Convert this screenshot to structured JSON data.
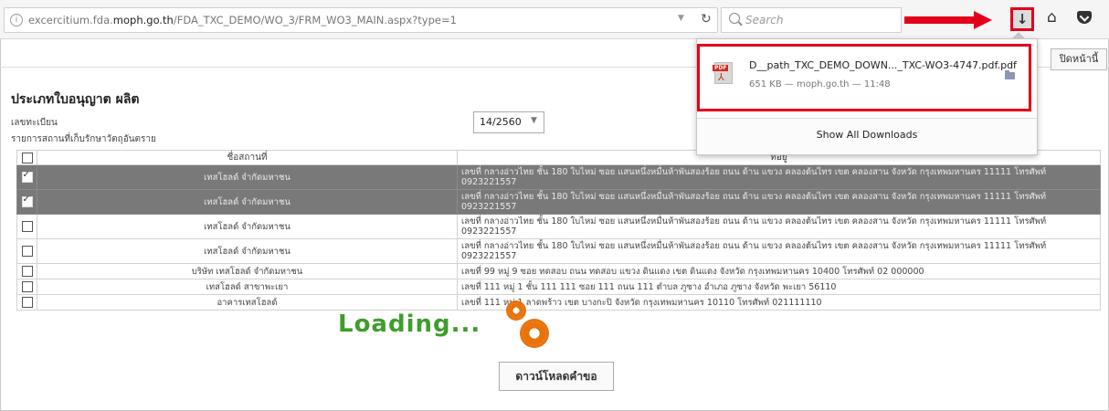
{
  "browser": {
    "url_host_prefix": "excercitium.fda.",
    "url_host_bold": "moph.go.th",
    "url_path": "/FDA_TXC_DEMO/WO_3/FRM_WO3_MAIN.aspx?type=1",
    "search_placeholder": "Search",
    "icons": [
      "info-icon",
      "dropdown-icon",
      "reload-icon",
      "search-icon",
      "download-icon",
      "home-icon",
      "pocket-icon"
    ],
    "highlight_color": "#e3001b"
  },
  "downloads_panel": {
    "filename": "D__path_TXC_DEMO_DOWN..._TXC-WO3-4747.pdf.pdf",
    "meta": "651 KB — moph.go.th — 11:48",
    "show_all_label": "Show All Downloads"
  },
  "page": {
    "top_right_button": "ปิดหน้านี้",
    "title": "ประเภทใบอนุญาต ผลิต",
    "registration_label": "เลขทะเบียน",
    "storage_label": "รายการสถานที่เก็บรักษาวัตถุอันตราย",
    "registration_value": "14/2560",
    "table": {
      "columns": [
        "",
        "ชื่อสถานที่",
        "ที่อยู่"
      ],
      "rows": [
        {
          "checked": true,
          "selected": true,
          "name": "เทสโฮลด์ จำกัดมหาชน",
          "address": "เลขที่ กลางอ่าวไทย ชั้น 180 ใบไหม่ ซอย แสนหนึ่งหมื่นห้าพันสองร้อย ถนน ด้าน แขวง คลองต้นไทร เขต คลองสาน จังหวัด กรุงเทพมหานคร 11111 โทรศัพท์ 0923221557"
        },
        {
          "checked": true,
          "selected": true,
          "name": "เทสโฮลด์ จำกัดมหาชน",
          "address": "เลขที่ กลางอ่าวไทย ชั้น 180 ใบไหม่ ซอย แสนหนึ่งหมื่นห้าพันสองร้อย ถนน ด้าน แขวง คลองต้นไทร เขต คลองสาน จังหวัด กรุงเทพมหานคร 11111 โทรศัพท์ 0923221557"
        },
        {
          "checked": false,
          "selected": false,
          "name": "เทสโฮลด์ จำกัดมหาชน",
          "address": "เลขที่ กลางอ่าวไทย ชั้น 180 ใบไหม่ ซอย แสนหนึ่งหมื่นห้าพันสองร้อย ถนน ด้าน แขวง คลองต้นไทร เขต คลองสาน จังหวัด กรุงเทพมหานคร 11111 โทรศัพท์ 0923221557"
        },
        {
          "checked": false,
          "selected": false,
          "name": "เทสโฮลด์ จำกัดมหาชน",
          "address": "เลขที่ กลางอ่าวไทย ชั้น 180 ใบไหม่ ซอย แสนหนึ่งหมื่นห้าพันสองร้อย ถนน ด้าน แขวง คลองต้นไทร เขต คลองสาน จังหวัด กรุงเทพมหานคร 11111 โทรศัพท์ 0923221557"
        },
        {
          "checked": false,
          "selected": false,
          "name": "บริษัท เทสโฮลด์ จำกัดมหาชน",
          "address": "เลขที่ 99 หมู่ 9 ซอย ทดสอบ ถนน ทดสอบ แขวง ดินแดง เขต ดินแดง จังหวัด กรุงเทพมหานคร 10400 โทรศัพท์ 02 000000"
        },
        {
          "checked": false,
          "selected": false,
          "name": "เทสโฮลด์ สาขาพะเยา",
          "address": "เลขที่ 111 หมู่ 1 ชั้น 111 111 ซอย 111 ถนน 111 ตำบล ภูซาง อำเภอ ภูซาง จังหวัด พะเยา 56110"
        },
        {
          "checked": false,
          "selected": false,
          "name": "อาคารเทสโฮลด์",
          "address": "เลขที่ 111 หมู่ 1 ลาดพร้าว เขต บางกะปิ จังหวัด กรุงเทพมหานคร 10110 โทรศัพท์ 021111110"
        }
      ]
    },
    "loading_text": "Loading...",
    "download_request_button": "ดาวน์โหลดคำขอ"
  }
}
